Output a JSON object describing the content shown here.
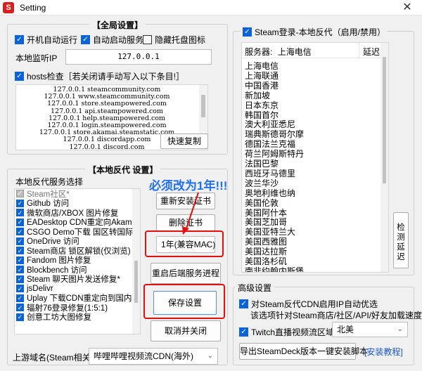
{
  "window": {
    "title": "Setting",
    "close_glyph": "✕"
  },
  "global": {
    "title": "【全局设置】",
    "autostart": "开机自动运行",
    "autoservice": "自动启动服务",
    "hide_tray": "隐藏托盘图标",
    "listen_label": "本地监听IP",
    "listen_value": "127.0.0.1",
    "hosts_label": "hosts检查［若关闭请手动写入以下条目!］",
    "hosts_lines": [
      "127.0.0.1 steamcommunity.com",
      "127.0.0.1 www.steamcommunity.com",
      "127.0.0.1 store.steampowered.com",
      "127.0.0.1 api.steampowered.com",
      "127.0.0.1 help.steampowered.com",
      "127.0.0.1 login.steampowered.com",
      "127.0.0.1 store.akamai.steamstatic.com",
      "127.0.0.1 discordapp.com",
      "127.0.0.1 discord.com"
    ],
    "copy_button": "快速复制"
  },
  "proxy": {
    "title": "【本地反代 设置】",
    "list_label": "本地反代服务选择",
    "items": [
      {
        "label": "Steam社区*",
        "state": "disabled"
      },
      {
        "label": "Github 访问",
        "state": "checked"
      },
      {
        "label": "微软商店/XBOX 图片修复",
        "state": "checked"
      },
      {
        "label": "EADesktop CDN重定向Akamai",
        "state": "checked"
      },
      {
        "label": "CSGO Demo下载 国区转国际",
        "state": "checked"
      },
      {
        "label": "OneDrive 访问",
        "state": "checked"
      },
      {
        "label": "Steam商店 锁区解锁(仅浏览)",
        "state": "checked"
      },
      {
        "label": "Fandom 图片修复",
        "state": "checked"
      },
      {
        "label": "Blockbench 访问",
        "state": "checked"
      },
      {
        "label": "Steam 聊天图片发送修复*",
        "state": "checked"
      },
      {
        "label": "jsDelivr",
        "state": "checked"
      },
      {
        "label": "Uplay 下载CDN重定向到国内",
        "state": "checked"
      },
      {
        "label": "辐射76登录修复(1:5:1)",
        "state": "checked"
      },
      {
        "label": "创意工坊大图修复",
        "state": "checked"
      }
    ],
    "reinstall_cert": "重新安装证书",
    "delete_cert": "删除证书",
    "cert_duration": "1年(兼容MAC)",
    "restart_service": "重启后端服务进程",
    "save": "保存设置",
    "cancel_close": "取消并关闭",
    "upstream_label": "上游域名(Steam相关):",
    "upstream_value": "哔哩哔哩视频流CDN(海外)"
  },
  "annotation": {
    "text": "必须改为1年!!!"
  },
  "steam_login": {
    "title": "Steam登录-本地反代（启用/禁用）",
    "col_server": "服务器:",
    "col_server_value": "上海电信",
    "col_latency": "延迟",
    "servers": [
      "上海电信",
      "上海联通",
      "中国香港",
      "新加坡",
      "日本东京",
      "韩国首尔",
      "澳大利亚悉尼",
      "瑞典斯德哥尔摩",
      "德国法兰克福",
      "荷兰阿姆斯特丹",
      "法国巴黎",
      "西班牙马德里",
      "波兰华沙",
      "奥地利维也纳",
      "美国伦敦",
      "美国阿什本",
      "美国芝加哥",
      "美国亚特兰大",
      "美国西雅图",
      "美国达拉斯",
      "美国洛杉矶",
      "南非约翰内斯堡"
    ],
    "side_button": "检测延迟"
  },
  "advanced": {
    "title": "高级设置",
    "cdn_line1": "对Steam反代CDN启用IP自动优选",
    "cdn_line2": "该选项针对Steam商店/社区/API/好友加载速度",
    "twitch_label": "Twitch直播视频流区域",
    "twitch_value": "北美",
    "export_button": "导出SteamDeck版本一键安装脚本",
    "tutorial_link": "[安装教程]"
  },
  "colors": {
    "accent": "#0a64d8",
    "highlight": "#e01010",
    "annotation": "#1e6ff2"
  }
}
